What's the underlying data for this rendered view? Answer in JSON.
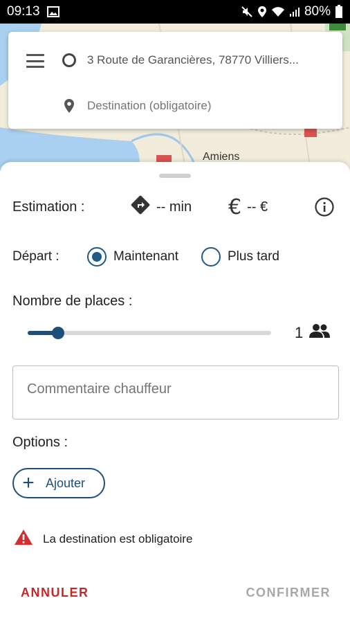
{
  "status_bar": {
    "time": "09:13",
    "battery": "80%",
    "icons": [
      "image-icon",
      "mute-icon",
      "location-icon",
      "wifi-icon",
      "signal-icon",
      "battery-icon"
    ]
  },
  "map": {
    "city_label": "Amiens"
  },
  "search": {
    "origin": "3 Route de Garancières, 78770 Villiers...",
    "destination_placeholder": "Destination (obligatoire)"
  },
  "estimation": {
    "label": "Estimation :",
    "time": "-- min",
    "price": "-- €"
  },
  "departure": {
    "label": "Départ :",
    "options": [
      {
        "label": "Maintenant",
        "selected": true
      },
      {
        "label": "Plus tard",
        "selected": false
      }
    ]
  },
  "places": {
    "label": "Nombre de places :",
    "value": "1",
    "slider_fraction": 0.125
  },
  "comment": {
    "placeholder": "Commentaire chauffeur"
  },
  "options": {
    "label": "Options :",
    "add_label": "Ajouter"
  },
  "warning": {
    "text": "La destination est obligatoire"
  },
  "actions": {
    "cancel": "ANNULER",
    "confirm": "CONFIRMER"
  },
  "colors": {
    "accent": "#1e4f7a",
    "cancel": "#c62828",
    "warning": "#d32f2f",
    "disabled": "#a8a8a8"
  }
}
